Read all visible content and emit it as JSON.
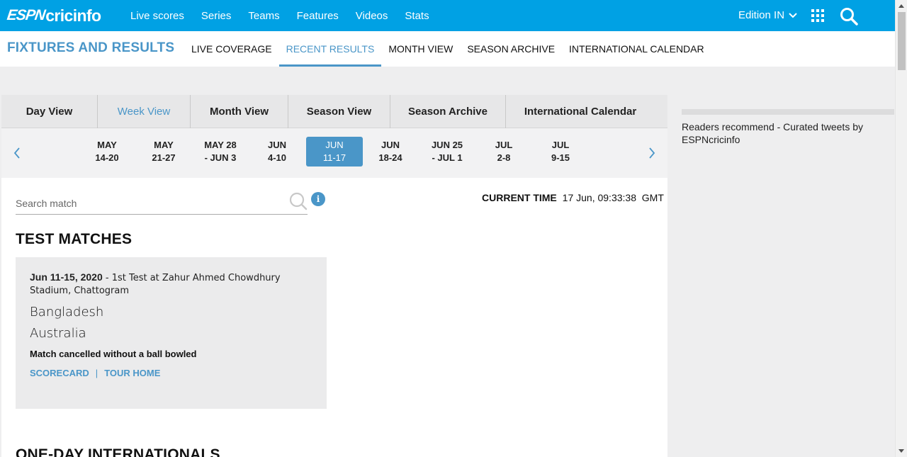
{
  "brand": {
    "espn": "ESPN",
    "cricinfo": "cricinfo"
  },
  "topnav": {
    "items": [
      "Live scores",
      "Series",
      "Teams",
      "Features",
      "Videos",
      "Stats"
    ],
    "edition": "Edition IN"
  },
  "subheader": {
    "title": "FIXTURES AND RESULTS",
    "items": [
      "LIVE COVERAGE",
      "RECENT RESULTS",
      "MONTH VIEW",
      "SEASON ARCHIVE",
      "INTERNATIONAL CALENDAR"
    ],
    "active": "RECENT RESULTS"
  },
  "view_tabs": [
    "Day View",
    "Week View",
    "Month View",
    "Season View",
    "Season Archive",
    "International Calendar"
  ],
  "active_view": "Week View",
  "weeks": [
    {
      "line1": "MAY",
      "line2": "14-20"
    },
    {
      "line1": "MAY",
      "line2": "21-27"
    },
    {
      "line1": "MAY 28",
      "line2": "- JUN 3"
    },
    {
      "line1": "JUN",
      "line2": "4-10"
    },
    {
      "line1": "JUN",
      "line2": "11-17"
    },
    {
      "line1": "JUN",
      "line2": "18-24"
    },
    {
      "line1": "JUN 25",
      "line2": "- JUL 1"
    },
    {
      "line1": "JUL",
      "line2": "2-8"
    },
    {
      "line1": "JUL",
      "line2": "9-15"
    }
  ],
  "active_week": "JUN 11-17",
  "search": {
    "placeholder": "Search match",
    "info": "i"
  },
  "current_time": {
    "label": "CURRENT TIME",
    "value": "17 Jun, 09:33:38  GMT"
  },
  "sections": {
    "test": "TEST MATCHES",
    "odi": "ONE-DAY INTERNATIONALS"
  },
  "match": {
    "date": "Jun 11-15, 2020",
    "desc": " - 1st Test at Zahur Ahmed Chowdhury Stadium, Chattogram",
    "team1": "Bangladesh",
    "team2": "Australia",
    "status": "Match cancelled without a ball bowled",
    "link1": "SCORECARD",
    "sep": "|",
    "link2": "TOUR HOME"
  },
  "rail": {
    "text": "Readers recommend - Curated tweets by ESPNcricinfo"
  },
  "colors": {
    "brand_blue": "#00a1e4",
    "accent": "#4a96c8"
  },
  "icons": [
    "chevron-down-icon",
    "apps-grid-icon",
    "search-icon",
    "chevron-left-icon",
    "chevron-right-icon",
    "magnifier-icon",
    "info-icon"
  ]
}
